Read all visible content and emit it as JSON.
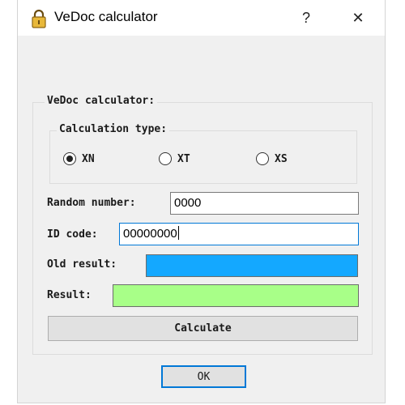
{
  "window": {
    "title": "VeDoc calculator",
    "title_icon": "padlock-icon",
    "help_label": "?",
    "close_label": "✕"
  },
  "group": {
    "label": "VeDoc calculator:"
  },
  "calculation_type": {
    "label": "Calculation type:",
    "options": [
      {
        "label": "XN",
        "checked": true
      },
      {
        "label": "XT",
        "checked": false
      },
      {
        "label": "XS",
        "checked": false
      }
    ]
  },
  "fields": {
    "random_number": {
      "label": "Random number:",
      "value": "0000"
    },
    "id_code": {
      "label": "ID code:",
      "value": "00000000"
    },
    "old_result": {
      "label": "Old result:",
      "value": "",
      "color": "#14a8ff"
    },
    "result": {
      "label": "Result:",
      "value": "",
      "color": "#a8ff88"
    }
  },
  "buttons": {
    "calculate": "Calculate",
    "ok": "OK"
  }
}
